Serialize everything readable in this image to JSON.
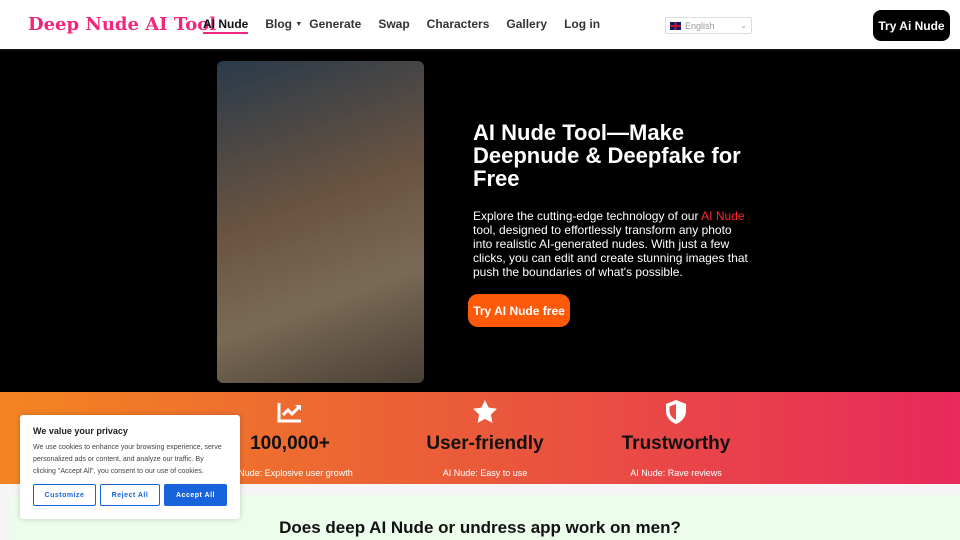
{
  "header": {
    "logo": "Deep Nude AI Tool",
    "nav": [
      "AI Nude",
      "Blog",
      "Generate",
      "Swap",
      "Characters",
      "Gallery",
      "Log in"
    ],
    "language": "English",
    "cta": "Try Ai Nude"
  },
  "hero": {
    "image": "portrait-photo",
    "title": "AI Nude Tool—Make Deepnude & Deepfake for Free",
    "desc_before": "Explore the cutting-edge technology of our ",
    "desc_link": "AI Nude",
    "desc_after": " tool, designed to effortlessly transform any photo into realistic AI-generated nudes. With just a few clicks, you can edit and create stunning images that push the boundaries of what's possible.",
    "cta": "Try AI Nude free"
  },
  "stats": [
    {
      "icon": "chart-up-icon",
      "value": "100,000+",
      "caption": "AI Nude: Explosive user growth"
    },
    {
      "icon": "star-icon",
      "value": "User-friendly",
      "caption": "AI Nude: Easy to use"
    },
    {
      "icon": "shield-icon",
      "value": "Trustworthy",
      "caption": "AI Nude: Rave reviews"
    }
  ],
  "faq": {
    "title": "Does deep AI Nude or undress app work on men?"
  },
  "cookie": {
    "title": "We value your privacy",
    "text": "We use cookies to enhance your browsing experience, serve personalized ads or content, and analyze our traffic. By clicking \"Accept All\", you consent to our use of cookies.",
    "customize": "Customize",
    "reject": "Reject All",
    "accept": "Accept All"
  },
  "colors": {
    "brand": "#f0287d",
    "cta": "#ff5a0a",
    "cookie_blue": "#1863dc"
  }
}
